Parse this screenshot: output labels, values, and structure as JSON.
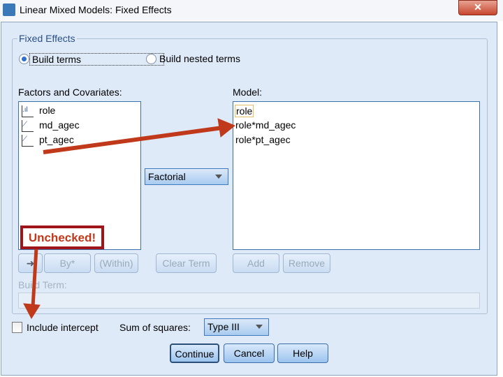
{
  "window": {
    "title": "Linear Mixed Models: Fixed Effects",
    "close_icon": "close-icon"
  },
  "group": {
    "label": "Fixed Effects"
  },
  "radios": [
    {
      "label": "Build terms",
      "selected": true
    },
    {
      "label": "Build nested terms",
      "selected": false
    }
  ],
  "factors": {
    "label": "Factors and Covariates:",
    "items": [
      {
        "name": "role",
        "icon": "nominal-icon"
      },
      {
        "name": "md_agec",
        "icon": "scale-icon"
      },
      {
        "name": "pt_agec",
        "icon": "scale-icon"
      }
    ]
  },
  "model": {
    "label": "Model:",
    "items": [
      "role",
      "role*md_agec",
      "role*pt_agec"
    ]
  },
  "term_type": {
    "value": "Factorial"
  },
  "buttons": {
    "arrow": "down-arrow-icon",
    "by": "By*",
    "within": "(Within)",
    "clear": "Clear Term",
    "add": "Add",
    "remove": "Remove"
  },
  "build_term": {
    "label": "Build Term:",
    "value": ""
  },
  "intercept": {
    "label": "Include intercept",
    "checked": false
  },
  "sum_of_squares": {
    "label": "Sum of squares:",
    "value": "Type III"
  },
  "footer": {
    "continue": "Continue",
    "cancel": "Cancel",
    "help": "Help"
  },
  "annotation": {
    "text": "Unchecked!",
    "color": "#c0391b",
    "box_border": "#a0151a"
  }
}
